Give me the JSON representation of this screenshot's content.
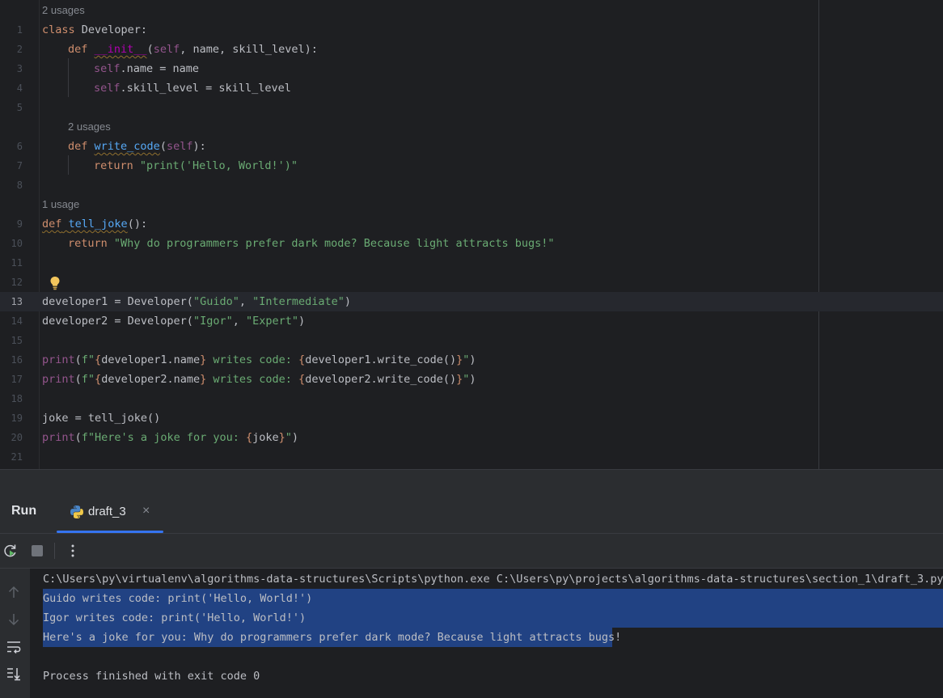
{
  "editor": {
    "usages_class": "2 usages",
    "usages_write_code": "2 usages",
    "usages_tell_joke": "1 usage",
    "line_numbers": [
      "1",
      "2",
      "3",
      "4",
      "5",
      "6",
      "7",
      "8",
      "9",
      "10",
      "11",
      "12",
      "13",
      "14",
      "15",
      "16",
      "17",
      "18",
      "19",
      "20",
      "21"
    ],
    "current_line": 13,
    "code": {
      "l1_kw": "class",
      "l1_name": " Developer:",
      "l2_def": "def",
      "l2_init": "__init__",
      "l2_open": "(",
      "l2_self": "self",
      "l2_rest": ", name, skill_level):",
      "l3_self": "self",
      "l3_rest": ".name = name",
      "l4_self": "self",
      "l4_rest": ".skill_level = skill_level",
      "l6_def": "def",
      "l6_fn": "write_code",
      "l6_open": "(",
      "l6_self": "self",
      "l6_close": "):",
      "l7_ret": "return",
      "l7_str": "\"print('Hello, World!')\"",
      "l9_def": "def",
      "l9_fn": "tell_joke",
      "l9_rest": "():",
      "l10_ret": "return",
      "l10_str": "\"Why do programmers prefer dark mode? Because light attracts bugs!\"",
      "l13_a": "developer1 = Developer(",
      "l13_s1": "\"Guido\"",
      "l13_c": ", ",
      "l13_s2": "\"Intermediate\"",
      "l13_e": ")",
      "l14_a": "developer2 = Developer(",
      "l14_s1": "\"Igor\"",
      "l14_c": ", ",
      "l14_s2": "\"Expert\"",
      "l14_e": ")",
      "l16_print": "print",
      "l16_open": "(",
      "l16_fq": "f\"",
      "l16_b1": "{",
      "l16_v1": "developer1.name",
      "l16_b2": "}",
      "l16_mid": " writes code: ",
      "l16_b3": "{",
      "l16_v2": "developer1.write_code()",
      "l16_b4": "}",
      "l16_q": "\"",
      "l16_close": ")",
      "l17_print": "print",
      "l17_open": "(",
      "l17_fq": "f\"",
      "l17_b1": "{",
      "l17_v1": "developer2.name",
      "l17_b2": "}",
      "l17_mid": " writes code: ",
      "l17_b3": "{",
      "l17_v2": "developer2.write_code()",
      "l17_b4": "}",
      "l17_q": "\"",
      "l17_close": ")",
      "l19": "joke = tell_joke()",
      "l20_print": "print",
      "l20_open": "(",
      "l20_fq": "f\"Here's a joke for you: ",
      "l20_b1": "{",
      "l20_v": "joke",
      "l20_b2": "}",
      "l20_q": "\"",
      "l20_close": ")"
    }
  },
  "run_panel": {
    "title": "Run",
    "tab_label": "draft_3",
    "tab_close": "×"
  },
  "console": {
    "command": "C:\\Users\\py\\virtualenv\\algorithms-data-structures\\Scripts\\python.exe C:\\Users\\py\\projects\\algorithms-data-structures\\section_1\\draft_3.py",
    "out1": "Guido writes code: print('Hello, World!')",
    "out2": "Igor writes code: print('Hello, World!')",
    "out3": "Here's a joke for you: Why do programmers prefer dark mode? Because light attracts bugs!",
    "exit": "Process finished with exit code 0"
  },
  "colors": {
    "keyword": "#cf8e6d",
    "function": "#56a8f5",
    "string": "#6aab73",
    "self": "#94558d",
    "selection": "#214283",
    "accent": "#3574f0"
  }
}
